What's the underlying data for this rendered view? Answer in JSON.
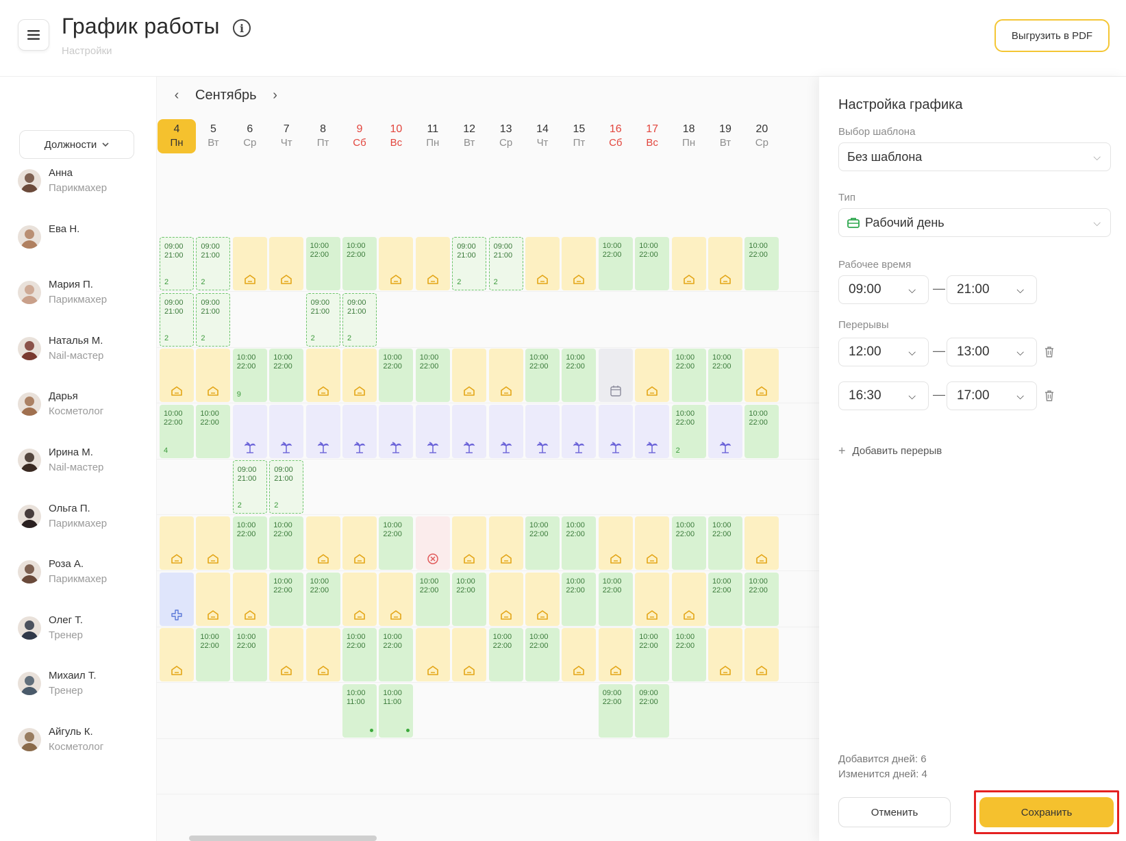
{
  "header": {
    "title": "График работы",
    "subtitle": "Настройки",
    "pdf_button": "Выгрузить в PDF"
  },
  "filters": {
    "positions_label": "Должности"
  },
  "calendar": {
    "month": "Сентябрь",
    "days": [
      {
        "num": "4",
        "wd": "Пн",
        "today": true,
        "weekend": false
      },
      {
        "num": "5",
        "wd": "Вт",
        "weekend": false
      },
      {
        "num": "6",
        "wd": "Ср",
        "weekend": false
      },
      {
        "num": "7",
        "wd": "Чт",
        "weekend": false
      },
      {
        "num": "8",
        "wd": "Пт",
        "weekend": false
      },
      {
        "num": "9",
        "wd": "Сб",
        "weekend": true
      },
      {
        "num": "10",
        "wd": "Вс",
        "weekend": true
      },
      {
        "num": "11",
        "wd": "Пн",
        "weekend": false
      },
      {
        "num": "12",
        "wd": "Вт",
        "weekend": false
      },
      {
        "num": "13",
        "wd": "Ср",
        "weekend": false
      },
      {
        "num": "14",
        "wd": "Чт",
        "weekend": false
      },
      {
        "num": "15",
        "wd": "Пт",
        "weekend": false
      },
      {
        "num": "16",
        "wd": "Сб",
        "weekend": true
      },
      {
        "num": "17",
        "wd": "Вс",
        "weekend": true
      },
      {
        "num": "18",
        "wd": "Пн",
        "weekend": false
      },
      {
        "num": "19",
        "wd": "Вт",
        "weekend": false
      },
      {
        "num": "20",
        "wd": "Ср",
        "weekend": false
      }
    ],
    "employees": [
      {
        "name": "Анна",
        "role": "Парикмахер",
        "avatar_color": "#6b4a3a",
        "cells": [
          "T:09:00|21:00|2",
          "T:09:00|21:00|2",
          "O",
          "O",
          "W:10:00|22:00",
          "W:10:00|22:00",
          "O",
          "O",
          "T:09:00|21:00|2",
          "T:09:00|21:00|2",
          "O",
          "O",
          "W:10:00|22:00",
          "W:10:00|22:00",
          "O",
          "O",
          "W:10:00|22:00"
        ]
      },
      {
        "name": "Ева Н.",
        "role": "",
        "avatar_color": "#b08060",
        "cells": [
          "T:09:00|21:00|2",
          "T:09:00|21:00|2",
          "",
          "",
          "T:09:00|21:00|2",
          "T:09:00|21:00|2",
          "",
          "",
          "",
          "",
          "",
          "",
          "",
          "",
          "",
          "",
          ""
        ]
      },
      {
        "name": "Мария П.",
        "role": "Парикмахер",
        "avatar_color": "#c9a08a",
        "cells": [
          "O",
          "O",
          "W:10:00|22:00|9",
          "W:10:00|22:00",
          "O",
          "O",
          "W:10:00|22:00",
          "W:10:00|22:00",
          "O",
          "O",
          "W:10:00|22:00",
          "W:10:00|22:00",
          "G",
          "O",
          "W:10:00|22:00",
          "W:10:00|22:00",
          "O"
        ]
      },
      {
        "name": "Наталья М.",
        "role": "Nail-мастер",
        "avatar_color": "#7a3a30",
        "cells": [
          "W:10:00|22:00|4",
          "W:10:00|22:00",
          "V",
          "V",
          "V",
          "V",
          "V",
          "V",
          "V",
          "V",
          "V",
          "V",
          "V",
          "V",
          "W:10:00|22:00|2",
          "V",
          "W:10:00|22:00"
        ]
      },
      {
        "name": "Дарья",
        "role": "Косметолог",
        "avatar_color": "#a0704f",
        "cells": [
          "",
          "",
          "T:09:00|21:00|2",
          "T:09:00|21:00|2",
          "",
          "",
          "",
          "",
          "",
          "",
          "",
          "",
          "",
          "",
          "",
          "",
          ""
        ]
      },
      {
        "name": "Ирина М.",
        "role": "Nail-мастер",
        "avatar_color": "#3a2a22",
        "cells": [
          "O",
          "O",
          "W:10:00|22:00",
          "W:10:00|22:00",
          "O",
          "O",
          "W:10:00|22:00",
          "S",
          "O",
          "O",
          "W:10:00|22:00",
          "W:10:00|22:00",
          "O",
          "O",
          "W:10:00|22:00",
          "W:10:00|22:00",
          "O"
        ]
      },
      {
        "name": "Ольга П.",
        "role": "Парикмахер",
        "avatar_color": "#2a2020",
        "cells": [
          "N",
          "O",
          "O",
          "W:10:00|22:00",
          "W:10:00|22:00",
          "O",
          "O",
          "W:10:00|22:00",
          "W:10:00|22:00",
          "O",
          "O",
          "W:10:00|22:00",
          "W:10:00|22:00",
          "O",
          "O",
          "W:10:00|22:00",
          "W:10:00|22:00"
        ]
      },
      {
        "name": "Роза А.",
        "role": "Парикмахер",
        "avatar_color": "#6a4a3a",
        "cells": [
          "O",
          "W:10:00|22:00",
          "W:10:00|22:00",
          "O",
          "O",
          "W:10:00|22:00",
          "W:10:00|22:00",
          "O",
          "O",
          "W:10:00|22:00",
          "W:10:00|22:00",
          "O",
          "O",
          "W:10:00|22:00",
          "W:10:00|22:00",
          "O",
          "O"
        ]
      },
      {
        "name": "Олег Т.",
        "role": "Тренер",
        "avatar_color": "#303848",
        "cells": [
          "",
          "",
          "",
          "",
          "",
          "D:10:00|11:00",
          "D:10:00|11:00",
          "",
          "",
          "",
          "",
          "",
          "W:09:00|22:00",
          "W:09:00|22:00",
          "",
          "",
          ""
        ]
      },
      {
        "name": "Михаил Т.",
        "role": "Тренер",
        "avatar_color": "#4a5a6a",
        "cells": [
          "",
          "",
          "",
          "",
          "",
          "",
          "",
          "",
          "",
          "",
          "",
          "",
          "",
          "",
          "",
          "",
          ""
        ]
      },
      {
        "name": "Айгуль К.",
        "role": "Косметолог",
        "avatar_color": "#8a6a4a",
        "cells": [
          "",
          "",
          "",
          "",
          "",
          "",
          "",
          "",
          "",
          "",
          "",
          "",
          "",
          "",
          "",
          "",
          ""
        ]
      }
    ]
  },
  "panel": {
    "title": "Настройка графика",
    "template_label": "Выбор шаблона",
    "template_value": "Без шаблона",
    "type_label": "Тип",
    "type_value": "Рабочий день",
    "worktime_label": "Рабочее время",
    "worktime_from": "09:00",
    "worktime_to": "21:00",
    "breaks_label": "Перерывы",
    "breaks": [
      {
        "from": "12:00",
        "to": "13:00"
      },
      {
        "from": "16:30",
        "to": "17:00"
      }
    ],
    "add_break": "Добавить перерыв",
    "summary_added": "Добавится дней: 6",
    "summary_changed": "Изменится дней: 4",
    "cancel": "Отменить",
    "save": "Сохранить"
  },
  "colors": {
    "accent": "#f5c12e",
    "work": "#d8f2d2",
    "off": "#fdf0c2",
    "vacation": "#ecebfb",
    "weekend_text": "#e2453d",
    "highlight": "#e42121"
  },
  "icons": {
    "off_day": "home-icon",
    "vacation": "palm-tree-icon",
    "sick": "close-circle-icon",
    "calendar": "calendar-icon",
    "add": "plus-icon",
    "delete": "trash-icon"
  }
}
